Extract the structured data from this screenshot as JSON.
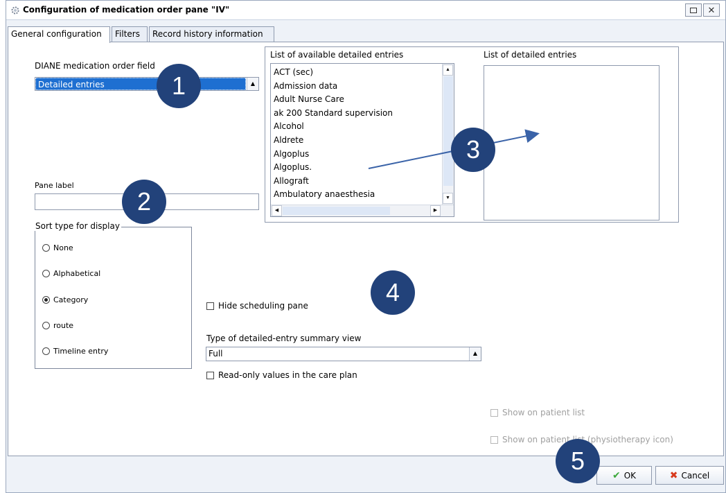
{
  "window": {
    "title": "Configuration of medication order pane \"IV\"",
    "maximize_icon": "maximize-icon",
    "close_label": "✕"
  },
  "tabs": [
    {
      "label": "General configuration",
      "active": true
    },
    {
      "label": "Filters",
      "active": false
    },
    {
      "label": "Record history information",
      "active": false
    }
  ],
  "general": {
    "order_field_label": "DIANE medication order field",
    "order_field_value": "Detailed entries",
    "pane_label_label": "Pane label",
    "pane_label_value": "",
    "sort": {
      "legend": "Sort type for display",
      "options": [
        {
          "label": "None",
          "checked": false
        },
        {
          "label": "Alphabetical",
          "checked": false
        },
        {
          "label": "Category",
          "checked": true
        },
        {
          "label": "route",
          "checked": false
        },
        {
          "label": "Timeline entry",
          "checked": false
        }
      ]
    },
    "available_list": {
      "label": "List of available detailed entries",
      "items": [
        "ACT (sec)",
        "Admission data",
        "Adult Nurse Care",
        "ak 200 Standard supervision",
        "Alcohol",
        "Aldrete",
        "Algoplus",
        "Algoplus.",
        "Allograft",
        "Ambulatory anaesthesia"
      ]
    },
    "detailed_list": {
      "label": "List of detailed entries",
      "items": []
    },
    "hide_scheduling": {
      "label": "Hide scheduling pane",
      "checked": false
    },
    "summary_view": {
      "label": "Type of detailed-entry summary view",
      "value": "Full"
    },
    "read_only": {
      "label": "Read-only values in the care plan",
      "checked": false
    },
    "show_patient_list": {
      "label": "Show on patient list",
      "checked": false,
      "disabled": true
    },
    "show_patient_list_physio": {
      "label": "Show on patient list (physiotherapy icon)",
      "checked": false,
      "disabled": true
    }
  },
  "buttons": {
    "ok": "OK",
    "cancel": "Cancel"
  },
  "annotations": [
    "1",
    "2",
    "3",
    "4",
    "5"
  ],
  "colors": {
    "badge": "#22427a",
    "selection": "#1e6fd1",
    "ok_icon": "#3ca83c",
    "cancel_icon": "#d83a1d"
  }
}
